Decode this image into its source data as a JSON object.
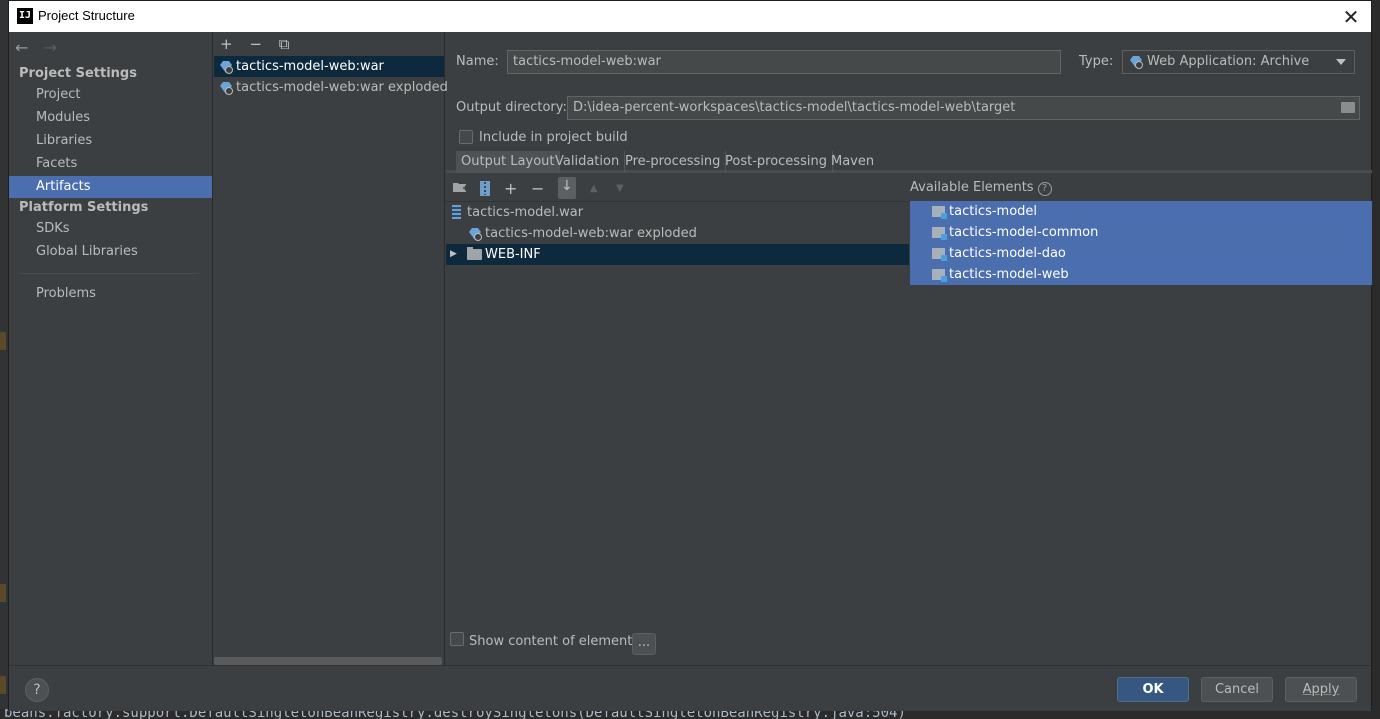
{
  "window": {
    "title": "Project Structure",
    "app_icon": "IJ",
    "close_symbol": "✕"
  },
  "nav": {
    "back_symbol": "←",
    "forward_symbol": "→",
    "project_settings_title": "Project Settings",
    "platform_settings_title": "Platform Settings",
    "items": {
      "project": "Project",
      "modules": "Modules",
      "libraries": "Libraries",
      "facets": "Facets",
      "artifacts": "Artifacts",
      "sdks": "SDKs",
      "global_libraries": "Global Libraries",
      "problems": "Problems"
    },
    "selected": "Artifacts"
  },
  "artifacts_toolbar": {
    "add": "+",
    "remove": "−",
    "copy": "⧉"
  },
  "artifacts": [
    {
      "label": "tactics-model-web:war",
      "selected": true
    },
    {
      "label": "tactics-model-web:war exploded",
      "selected": false
    }
  ],
  "form": {
    "name_label": "Name:",
    "name_value": "tactics-model-web:war",
    "type_label": "Type:",
    "type_value": "Web Application: Archive",
    "output_label": "Output directory:",
    "output_value": "D:\\idea-percent-workspaces\\tactics-model\\tactics-model-web\\target",
    "include_label": "Include in project build",
    "include_checked": false
  },
  "tabs": {
    "output_layout": "Output Layout",
    "validation": "Validation",
    "pre_processing": "Pre-processing",
    "post_processing": "Post-processing",
    "maven": "Maven",
    "active": "Output Layout"
  },
  "layout_toolbar": {
    "add": "+",
    "remove": "−",
    "up": "▲",
    "down": "▼",
    "sort": "↓"
  },
  "output_tree": [
    {
      "label": "tactics-model.war"
    },
    {
      "label": "tactics-model-web:war exploded"
    },
    {
      "label": "WEB-INF",
      "arrow": "▶",
      "selected": true
    }
  ],
  "available": {
    "title": "Available Elements",
    "help": "?",
    "items": [
      "tactics-model",
      "tactics-model-common",
      "tactics-model-dao",
      "tactics-model-web"
    ]
  },
  "show_content": {
    "label": "Show content of elements",
    "checked": false,
    "more_button": "..."
  },
  "buttons": {
    "help": "?",
    "ok": "OK",
    "cancel": "Cancel",
    "apply": "Apply"
  },
  "background_console": "beans.factory.support.DefaultSingletonBeanRegistry.destroySingletons(DefaultSingletonBeanRegistry.java:504)",
  "colors": {
    "selection_blue": "#4b6eaf",
    "selection_dark": "#0d293e",
    "panel": "#3c3f41",
    "ok_button": "#365880"
  }
}
